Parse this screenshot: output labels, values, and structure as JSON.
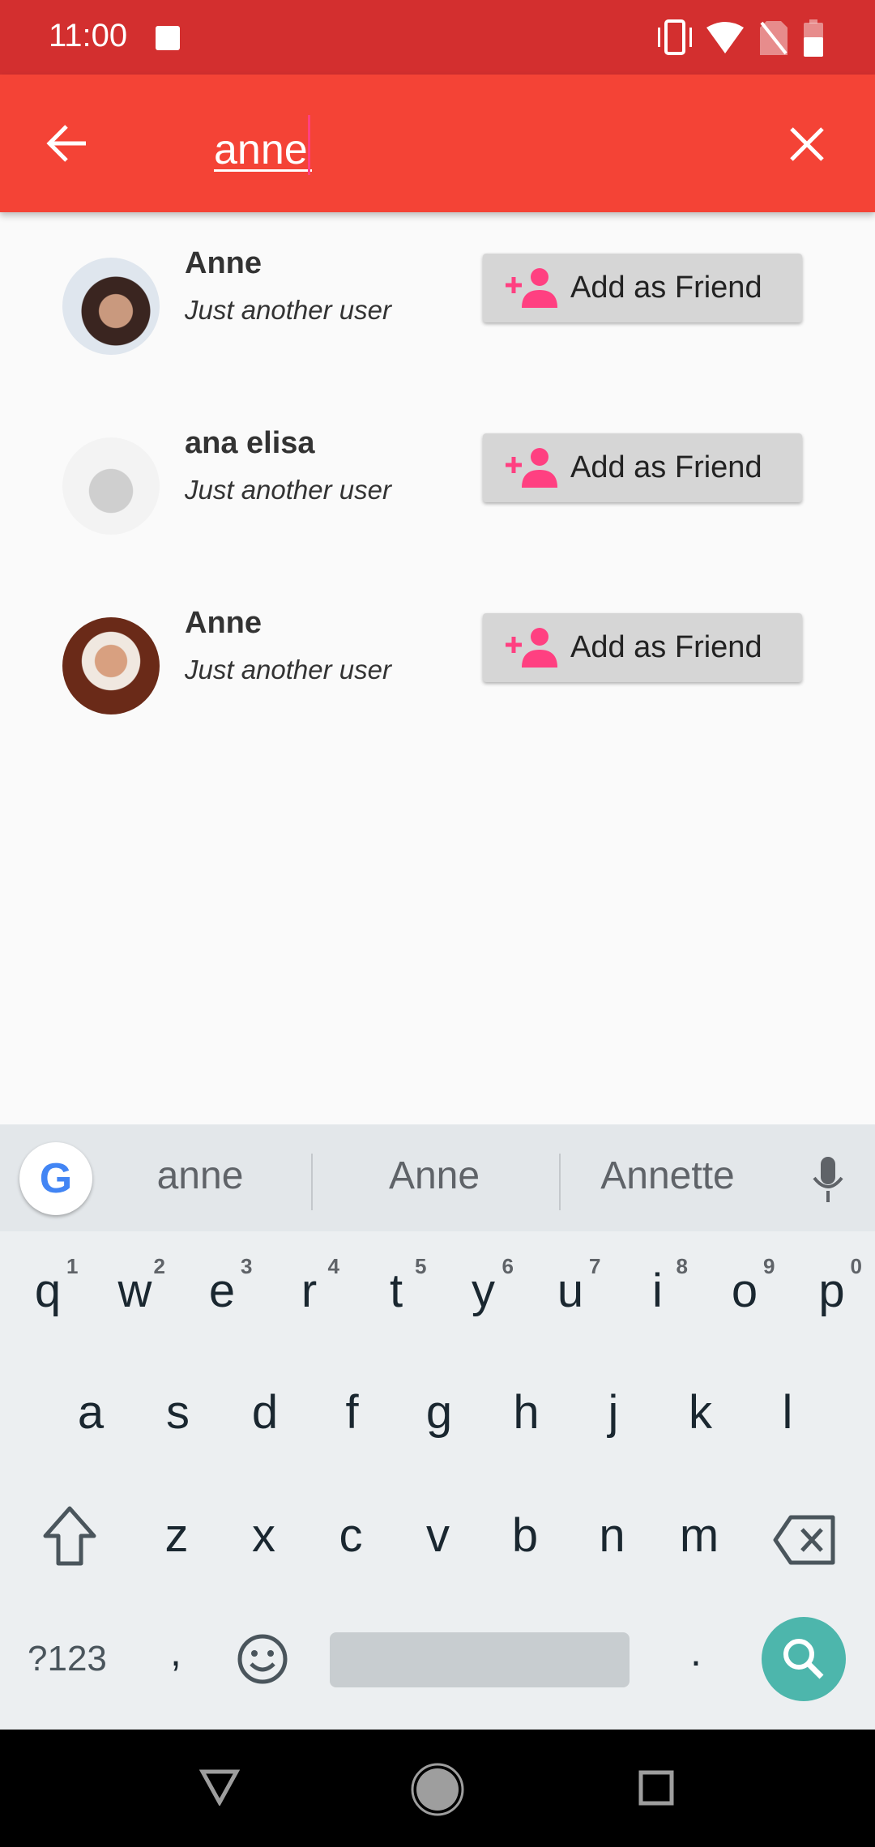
{
  "status_bar": {
    "time": "11:00",
    "icons": [
      "image-icon",
      "vibrate-icon",
      "wifi-icon",
      "no-sim-icon",
      "battery-icon"
    ]
  },
  "app_bar": {
    "search_value": "anne",
    "back_icon": "arrow-left-icon",
    "clear_icon": "close-icon",
    "color": "#f44336"
  },
  "results": [
    {
      "name": "Anne",
      "subtitle": "Just another user",
      "button": "Add as Friend"
    },
    {
      "name": "ana elisa",
      "subtitle": "Just another user",
      "button": "Add as Friend"
    },
    {
      "name": "Anne",
      "subtitle": "Just another user",
      "button": "Add as Friend"
    }
  ],
  "keyboard": {
    "suggestions": [
      "anne",
      "Anne",
      "Annette"
    ],
    "row1": [
      "q",
      "w",
      "e",
      "r",
      "t",
      "y",
      "u",
      "i",
      "o",
      "p"
    ],
    "row1_nums": [
      "1",
      "2",
      "3",
      "4",
      "5",
      "6",
      "7",
      "8",
      "9",
      "0"
    ],
    "row2": [
      "a",
      "s",
      "d",
      "f",
      "g",
      "h",
      "j",
      "k",
      "l"
    ],
    "row3": [
      "z",
      "x",
      "c",
      "v",
      "b",
      "n",
      "m"
    ],
    "symbols": "?123",
    "comma": ",",
    "period": ".",
    "accent": "#4db6ac"
  },
  "accent_pink": "#ff4081"
}
